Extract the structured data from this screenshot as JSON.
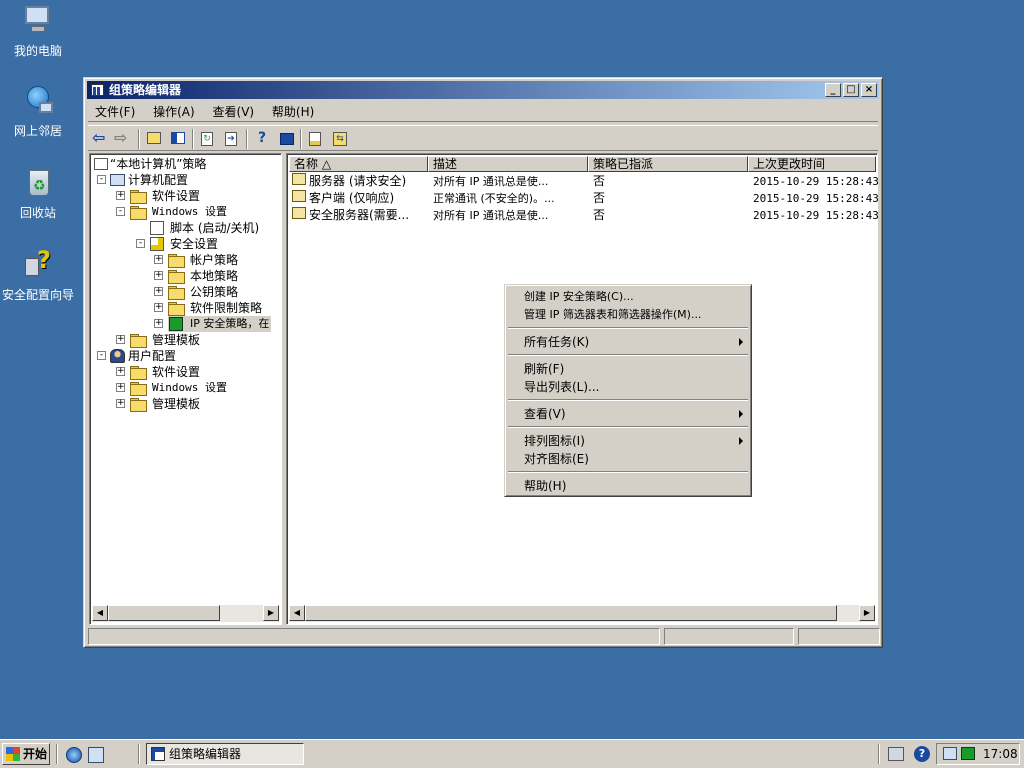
{
  "desktop": {
    "icons": [
      {
        "label": "我的电脑",
        "icon": "my-computer-icon"
      },
      {
        "label": "网上邻居",
        "icon": "network-places-icon"
      },
      {
        "label": "回收站",
        "icon": "recycle-bin-icon"
      },
      {
        "label": "安全配置向导",
        "icon": "security-wizard-icon"
      }
    ]
  },
  "window": {
    "title": "组策略编辑器",
    "menu": [
      "文件(F)",
      "操作(A)",
      "查看(V)",
      "帮助(H)"
    ]
  },
  "tree": {
    "root": "“本地计算机”策略",
    "computer_config": "计算机配置",
    "software_settings": "软件设置",
    "windows_settings": "Windows 设置",
    "scripts": "脚本 (启动/关机)",
    "security_settings": "安全设置",
    "account_policies": "帐户策略",
    "local_policies": "本地策略",
    "public_key_policies": "公钥策略",
    "software_restriction": "软件限制策略",
    "ip_security": "IP 安全策略，在",
    "admin_templates": "管理模板",
    "user_config": "用户配置",
    "user_software_settings": "软件设置",
    "user_windows_settings": "Windows 设置",
    "user_admin_templates": "管理模板"
  },
  "list": {
    "columns": [
      "名称 △",
      "描述",
      "策略已指派",
      "上次更改时间"
    ],
    "rows": [
      {
        "name": "服务器 (请求安全)",
        "desc": "对所有 IP 通讯总是使...",
        "assigned": "否",
        "modified": "2015-10-29 15:28:43"
      },
      {
        "name": "客户端 (仅响应)",
        "desc": "正常通讯 (不安全的)。...",
        "assigned": "否",
        "modified": "2015-10-29 15:28:43"
      },
      {
        "name": "安全服务器(需要...",
        "desc": "对所有 IP 通讯总是使...",
        "assigned": "否",
        "modified": "2015-10-29 15:28:43"
      }
    ]
  },
  "context_menu": {
    "create_policy": "创建 IP 安全策略(C)...",
    "manage_filters": "管理 IP 筛选器表和筛选器操作(M)...",
    "all_tasks": "所有任务(K)",
    "refresh": "刷新(F)",
    "export_list": "导出列表(L)...",
    "view": "查看(V)",
    "arrange_icons": "排列图标(I)",
    "line_up_icons": "对齐图标(E)",
    "help": "帮助(H)"
  },
  "taskbar": {
    "start": "开始",
    "task": "组策略编辑器",
    "clock": "17:08"
  }
}
